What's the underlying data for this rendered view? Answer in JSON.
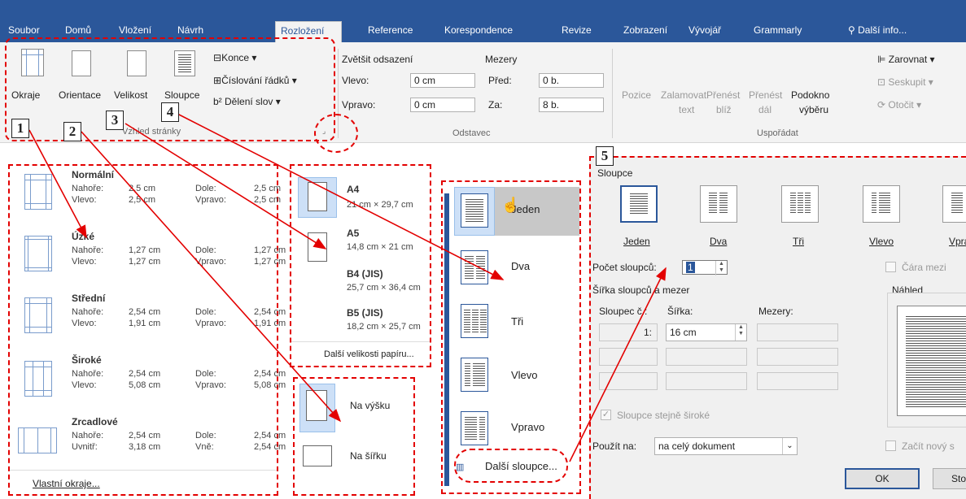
{
  "ribbon": {
    "tabs": [
      "Soubor",
      "Domů",
      "Vložení",
      "Návrh",
      "Rozložení",
      "Reference",
      "Korespondence",
      "Revize",
      "Zobrazení",
      "Vývojář",
      "Grammarly"
    ],
    "active_tab": "Rozložení",
    "tell_me": "Další info...",
    "page_setup": {
      "margins": "Okraje",
      "orientation": "Orientace",
      "size": "Velikost",
      "columns": "Sloupce",
      "breaks": "Konce",
      "line_numbers": "Číslování řádků",
      "hyphenation": "Dělení slov",
      "group_label": "Vzhled stránky"
    },
    "paragraph": {
      "indent_title": "Zvětšit odsazení",
      "spacing_title": "Mezery",
      "left_label": "Vlevo:",
      "left_value": "0 cm",
      "right_label": "Vpravo:",
      "right_value": "0 cm",
      "before_label": "Před:",
      "before_value": "0 b.",
      "after_label": "Za:",
      "after_value": "8 b.",
      "group_label": "Odstavec"
    },
    "arrange": {
      "position": "Pozice",
      "wrap_line1": "Zalamovat",
      "wrap_line2": "text",
      "forward_line1": "Přenést",
      "forward_line2": "blíž",
      "backward_line1": "Přenést",
      "backward_line2": "dál",
      "pane_line1": "Podokno",
      "pane_line2": "výběru",
      "align": "Zarovnat",
      "group": "Seskupit",
      "rotate": "Otočit",
      "group_label": "Uspořádat"
    }
  },
  "callouts": [
    "1",
    "2",
    "3",
    "4",
    "5"
  ],
  "margins_panel": {
    "items": [
      {
        "name": "Normální",
        "r1l": "Nahoře:",
        "r1v": "2,5 cm",
        "r1l2": "Dole:",
        "r1v2": "2,5 cm",
        "r2l": "Vlevo:",
        "r2v": "2,5 cm",
        "r2l2": "Vpravo:",
        "r2v2": "2,5 cm"
      },
      {
        "name": "Úzké",
        "r1l": "Nahoře:",
        "r1v": "1,27 cm",
        "r1l2": "Dole:",
        "r1v2": "1,27 cm",
        "r2l": "Vlevo:",
        "r2v": "1,27 cm",
        "r2l2": "Vpravo:",
        "r2v2": "1,27 cm"
      },
      {
        "name": "Střední",
        "r1l": "Nahoře:",
        "r1v": "2,54 cm",
        "r1l2": "Dole:",
        "r1v2": "2,54 cm",
        "r2l": "Vlevo:",
        "r2v": "1,91 cm",
        "r2l2": "Vpravo:",
        "r2v2": "1,91 cm"
      },
      {
        "name": "Široké",
        "r1l": "Nahoře:",
        "r1v": "2,54 cm",
        "r1l2": "Dole:",
        "r1v2": "2,54 cm",
        "r2l": "Vlevo:",
        "r2v": "5,08 cm",
        "r2l2": "Vpravo:",
        "r2v2": "5,08 cm"
      },
      {
        "name": "Zrcadlové",
        "r1l": "Nahoře:",
        "r1v": "2,54 cm",
        "r1l2": "Dole:",
        "r1v2": "2,54 cm",
        "r2l": "Uvnitř:",
        "r2v": "3,18 cm",
        "r2l2": "Vně:",
        "r2v2": "2,54 cm"
      }
    ],
    "custom": "Vlastní okraje..."
  },
  "size_panel": {
    "items": [
      {
        "name": "A4",
        "dims": "21 cm × 29,7 cm"
      },
      {
        "name": "A5",
        "dims": "14,8 cm × 21 cm"
      },
      {
        "name": "B4 (JIS)",
        "dims": "25,7 cm × 36,4 cm"
      },
      {
        "name": "B5 (JIS)",
        "dims": "18,2 cm × 25,7 cm"
      }
    ],
    "more": "Další velikosti papíru..."
  },
  "orientation_panel": {
    "portrait": "Na výšku",
    "landscape": "Na šířku"
  },
  "columns_panel": {
    "items": [
      "Jeden",
      "Dva",
      "Tři",
      "Vlevo",
      "Vpravo"
    ],
    "more": "Další sloupce..."
  },
  "columns_dialog": {
    "presets_title": "Sloupce",
    "presets": [
      "Jeden",
      "Dva",
      "Tři",
      "Vlevo",
      "Vpra"
    ],
    "count_label": "Počet sloupců:",
    "count_value": "1",
    "line_between": "Čára mezi",
    "width_spacing_title": "Šířka sloupců a mezer",
    "col_header": "Sloupec č.:",
    "width_header": "Šířka:",
    "spacing_header": "Mezery:",
    "row1_num": "1:",
    "row1_width": "16 cm",
    "equal_width": "Sloupce stejně široké",
    "preview_title": "Náhled",
    "apply_label": "Použít na:",
    "apply_value": "na celý dokument",
    "new_column": "Začít nový s",
    "ok": "OK",
    "cancel": "Sto"
  },
  "colors": {
    "ribbon_blue": "#2b579a",
    "callout_red": "#e30000",
    "selected_blue": "#cde0f7"
  }
}
